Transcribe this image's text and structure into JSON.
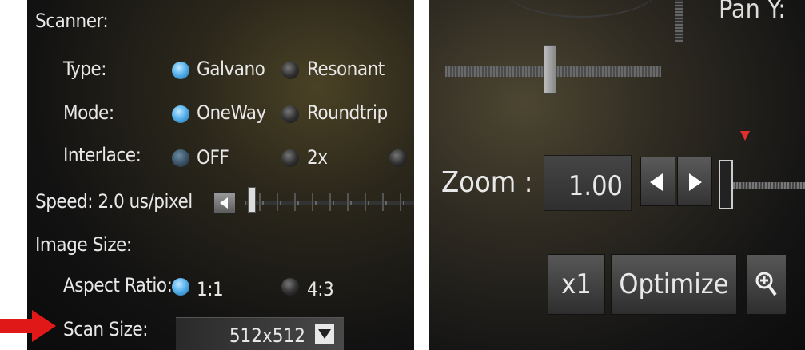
{
  "scanner": {
    "heading": "Scanner:",
    "type": {
      "label": "Type:",
      "options": [
        "Galvano",
        "Resonant"
      ],
      "selected": "Galvano"
    },
    "mode": {
      "label": "Mode:",
      "options": [
        "OneWay",
        "Roundtrip"
      ],
      "selected": "OneWay"
    },
    "interlace": {
      "label": "Interlace:",
      "options": [
        "OFF",
        "2x"
      ],
      "selected": "OFF"
    },
    "speed": {
      "label": "Speed:",
      "value": "2.0 us/pixel"
    },
    "image_size": {
      "heading": "Image Size:",
      "aspect_ratio": {
        "label": "Aspect Ratio:",
        "options": [
          "1:1",
          "4:3"
        ],
        "selected": "1:1"
      },
      "scan_size": {
        "label": "Scan Size:",
        "value": "512x512"
      }
    }
  },
  "zoom": {
    "label": "Zoom :",
    "value": "1.00",
    "buttons": {
      "x1": "x1",
      "optimize": "Optimize"
    }
  },
  "top_partial_text": "Pan Y:",
  "colors": {
    "selected_radio": "#59b3ec",
    "marker": "#e23030"
  },
  "icons": [
    "left-arrow-icon",
    "right-arrow-icon",
    "dropdown-caret-icon",
    "zoom-in-icon",
    "red-pointer-arrow-icon"
  ]
}
